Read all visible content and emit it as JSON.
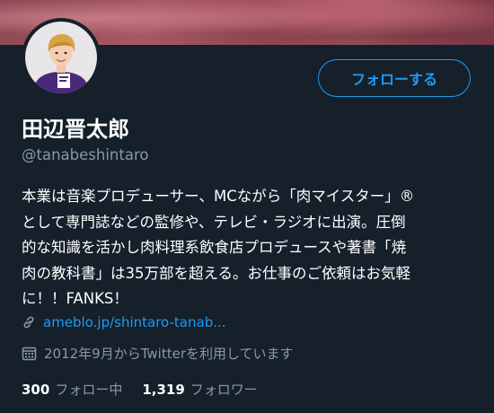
{
  "profile": {
    "name": "田辺晋太郎",
    "handle": "@tanabeshintaro",
    "follow_label": "フォローする",
    "bio_lines": [
      "本業は音楽プロデューサー、MCながら「肉マイスター」®",
      "として専門誌などの監修や、テレビ・ラジオに出演。圧倒",
      "的な知識を活かし肉料理系飲食店プロデュースや著書「焼",
      "肉の教科書」は35万部を超える。お仕事のご依頼はお気軽",
      "に！！FANKS！"
    ],
    "link_text": "ameblo.jp/shintaro-tanab...",
    "joined_text": "2012年9月からTwitterを利用しています"
  },
  "stats": {
    "following_count": "300",
    "following_label": "フォロー中",
    "followers_count": "1,319",
    "followers_label": "フォロワー"
  },
  "icons": {
    "link": "link-icon",
    "calendar": "calendar-icon"
  },
  "colors": {
    "background": "#15202b",
    "accent": "#1d9bf0",
    "secondary_text": "#8b98a5"
  }
}
